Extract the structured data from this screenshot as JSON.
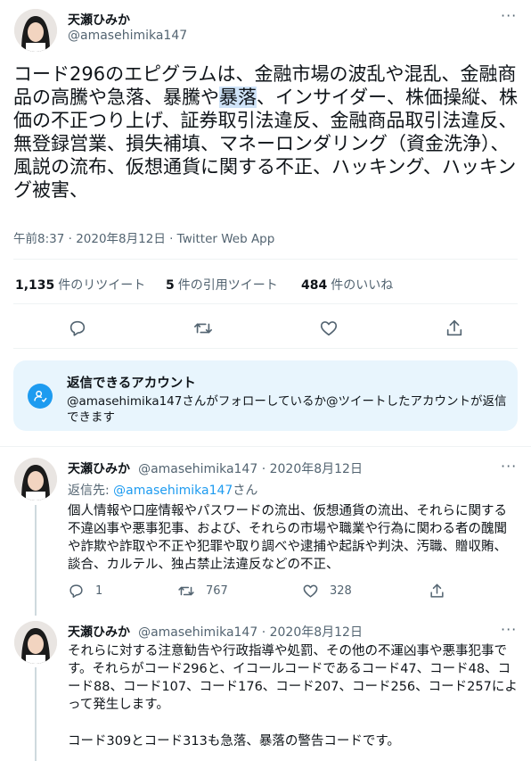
{
  "main_tweet": {
    "author_name": "天瀬ひみか",
    "handle": "@amasehimika147",
    "text_before": "コード296のエピグラムは、金融市場の波乱や混乱、金融商品の高騰や急落、暴騰や",
    "text_highlight": "暴落",
    "text_after": "、インサイダー、株価操縦、株価の不正つり上げ、証券取引法違反、金融商品取引法違反、無登録営業、損失補填、マネーロンダリング（資金洗浄）、風説の流布、仮想通貨に関する不正、ハッキング、ハッキング被害、",
    "timestamp": "午前8:37 · 2020年8月12日 · Twitter Web App"
  },
  "stats": {
    "retweets_count": "1,135",
    "retweets_label": "件のリツイート",
    "quotes_count": "5",
    "quotes_label": "件の引用ツイート",
    "likes_count": "484",
    "likes_label": "件のいいね"
  },
  "reply_card": {
    "title": "返信できるアカウント",
    "body": "@amasehimika147さんがフォローしているか@ツイートしたアカウントが返信できます"
  },
  "replies": [
    {
      "author_name": "天瀬ひみか",
      "handle_date": "@amasehimika147 · 2020年8月12日",
      "reply_prefix": "返信先: ",
      "reply_handle": "@amasehimika147",
      "reply_suffix": "さん",
      "text": "個人情報や口座情報やパスワードの流出、仮想通貨の流出、それらに関する不違凶事や悪事犯事、および、それらの市場や職業や行為に関わる者の醜聞や詐欺や詐取や不正や犯罪や取り調べや逮捕や起訴や判決、汚職、贈収賄、談合、カルテル、独占禁止法違反などの不正、",
      "reply_count": "1",
      "retweet_count": "767",
      "like_count": "328"
    },
    {
      "author_name": "天瀬ひみか",
      "handle_date": "@amasehimika147 · 2020年8月12日",
      "text": "それらに対する注意勧告や行政指導や処罰、その他の不運凶事や悪事犯事です。それらがコード296と、イコールコードであるコード47、コード48、コード88、コード107、コード176、コード207、コード256、コード257によって発生します。",
      "text2": "コード309とコード313も急落、暴落の警告コードです。"
    }
  ],
  "colors": {
    "accent": "#1d9bf0",
    "secondary_text": "#536471",
    "card_bg": "#e8f5fd"
  }
}
